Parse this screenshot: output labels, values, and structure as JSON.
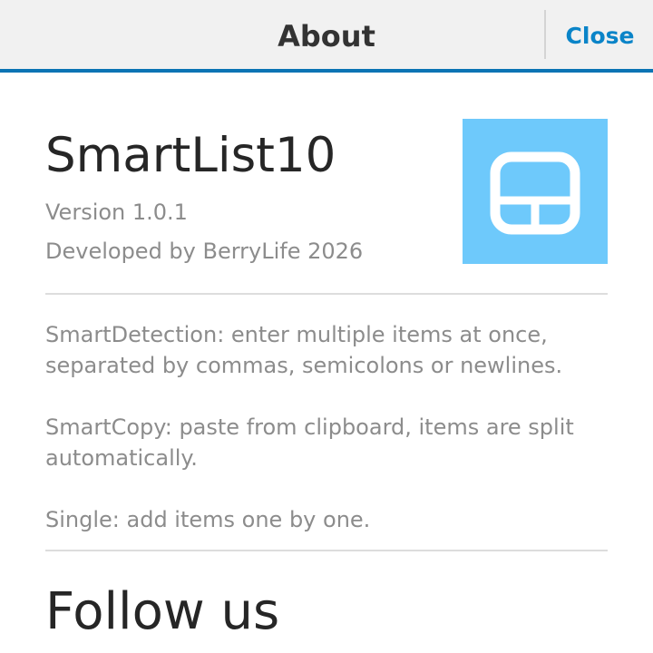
{
  "titlebar": {
    "title": "About",
    "close_label": "Close",
    "accent_color": "#0a74b4"
  },
  "app": {
    "name": "SmartList10",
    "version": "Version 1.0.1",
    "developer": "Developed by BerryLife 2026",
    "icon": "smartlist-app-icon",
    "icon_color": "#6ec9fb"
  },
  "features": [
    "SmartDetection: enter multiple items at once, separated by commas, semicolons or newlines.",
    "SmartCopy: paste from clipboard, items are split automatically.",
    "Single: add items one by one."
  ],
  "follow": {
    "heading": "Follow us"
  }
}
